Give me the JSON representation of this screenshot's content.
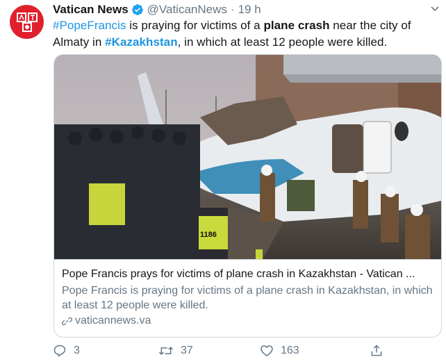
{
  "account": {
    "name": "Vatican News",
    "handle": "@VaticanNews",
    "separator": "·",
    "time": "19 h",
    "avatar_logo": "vatican-news-logo"
  },
  "tweet": {
    "t1": "#PopeFrancis",
    "t2": " is praying for victims of a ",
    "t3": "plane crash",
    "t4": " near the city of Almaty in ",
    "t5": "#Kazakhstan",
    "t6": ", in which at least 12 people were killed."
  },
  "card": {
    "image_badge": "1186",
    "title": "Pope Francis prays for victims of plane crash in Kazakhstan - Vatican ...",
    "description": "Pope Francis is praying for victims of a plane crash in Kazakhstan, in which at least 12 people were killed.",
    "domain": "vaticannews.va"
  },
  "actions": {
    "replies": "3",
    "retweets": "37",
    "likes": "163"
  },
  "colors": {
    "link": "#1b95e0",
    "muted": "#657786",
    "brand": "#e0212d"
  }
}
